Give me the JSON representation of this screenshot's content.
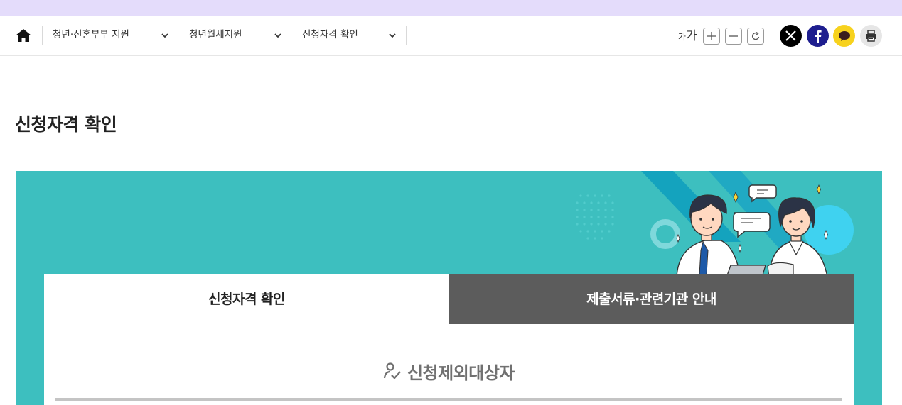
{
  "top_strip": {
    "color": "#e4dcfb"
  },
  "nav": {
    "home_icon": "home-icon",
    "crumbs": [
      {
        "label": "청년·신혼부부 지원"
      },
      {
        "label": "청년월세지원"
      },
      {
        "label": "신청자격 확인"
      }
    ],
    "font_size_label_small": "가",
    "font_size_label_big": "가",
    "font_buttons": [
      "plus-icon",
      "minus-icon",
      "reset-icon"
    ],
    "share_buttons": [
      "x-icon",
      "facebook-icon",
      "kakaotalk-icon",
      "print-icon"
    ]
  },
  "page": {
    "title": "신청자격 확인"
  },
  "banner": {
    "color": "#3dbfbf"
  },
  "tabs": [
    {
      "label": "신청자격 확인",
      "active": true
    },
    {
      "label": "제출서류·관련기관 안내",
      "active": false
    }
  ],
  "section": {
    "title": "신청제외대상자",
    "icon": "person-check-icon"
  }
}
